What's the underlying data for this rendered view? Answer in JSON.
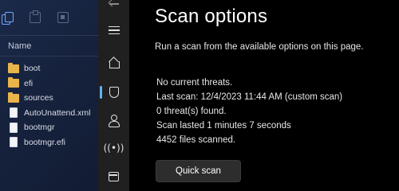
{
  "explorer": {
    "column_header": "Name",
    "items": [
      {
        "type": "folder",
        "label": "boot"
      },
      {
        "type": "folder",
        "label": "efi"
      },
      {
        "type": "folder",
        "label": "sources"
      },
      {
        "type": "file",
        "label": "AutoUnattend.xml"
      },
      {
        "type": "file",
        "label": "bootmgr"
      },
      {
        "type": "file",
        "label": "bootmgr.efi"
      }
    ],
    "toolbar_icons": [
      "copy-icon",
      "paste-icon",
      "rename-icon"
    ],
    "folder_color": "#e9b44a"
  },
  "nav": {
    "icons": [
      "back-icon",
      "hamburger-icon",
      "home-icon",
      "shield-icon",
      "person-icon",
      "wifi-icon",
      "window-icon"
    ],
    "active": "shield-icon",
    "accent": "#60b0ff"
  },
  "main": {
    "title": "Scan options",
    "description": "Run a scan from the available options on this page.",
    "status": {
      "threats": "No current threats.",
      "last_scan": "Last scan: 12/4/2023 11:44 AM (custom scan)",
      "found": "0 threat(s) found.",
      "duration": "Scan lasted 1 minutes 7 seconds",
      "files": "4452 files scanned."
    },
    "quick_scan_label": "Quick scan"
  }
}
